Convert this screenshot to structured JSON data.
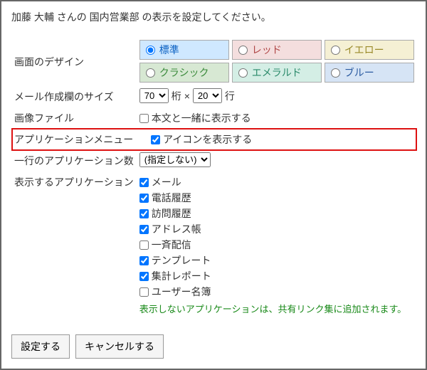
{
  "prompt": "加藤 大輔 さんの 国内営業部 の表示を設定してください。",
  "labels": {
    "design": "画面のデザイン",
    "mail_size": "メール作成欄のサイズ",
    "image_file": "画像ファイル",
    "app_menu": "アプリケーションメニュー",
    "apps_per_row": "一行のアプリケーション数",
    "apps_to_show": "表示するアプリケーション"
  },
  "design_options": {
    "standard": "標準",
    "red": "レッド",
    "yellow": "イエロー",
    "classic": "クラシック",
    "emerald": "エメラルド",
    "blue": "ブルー"
  },
  "design_selected": "standard",
  "mail_size": {
    "cols_value": "70",
    "cols_unit": "桁",
    "sep": "×",
    "rows_value": "20",
    "rows_unit": "行"
  },
  "image_file": {
    "label": "本文と一緒に表示する",
    "checked": false
  },
  "app_menu": {
    "label": "アイコンを表示する",
    "checked": true
  },
  "apps_per_row": {
    "value": "(指定しない)"
  },
  "apps_to_show": {
    "items": [
      {
        "label": "メール",
        "checked": true
      },
      {
        "label": "電話履歴",
        "checked": true
      },
      {
        "label": "訪問履歴",
        "checked": true
      },
      {
        "label": "アドレス帳",
        "checked": true
      },
      {
        "label": "一斉配信",
        "checked": false
      },
      {
        "label": "テンプレート",
        "checked": true
      },
      {
        "label": "集計レポート",
        "checked": true
      },
      {
        "label": "ユーザー名簿",
        "checked": false
      }
    ],
    "note": "表示しないアプリケーションは、共有リンク集に追加されます。"
  },
  "buttons": {
    "submit": "設定する",
    "cancel": "キャンセルする"
  }
}
